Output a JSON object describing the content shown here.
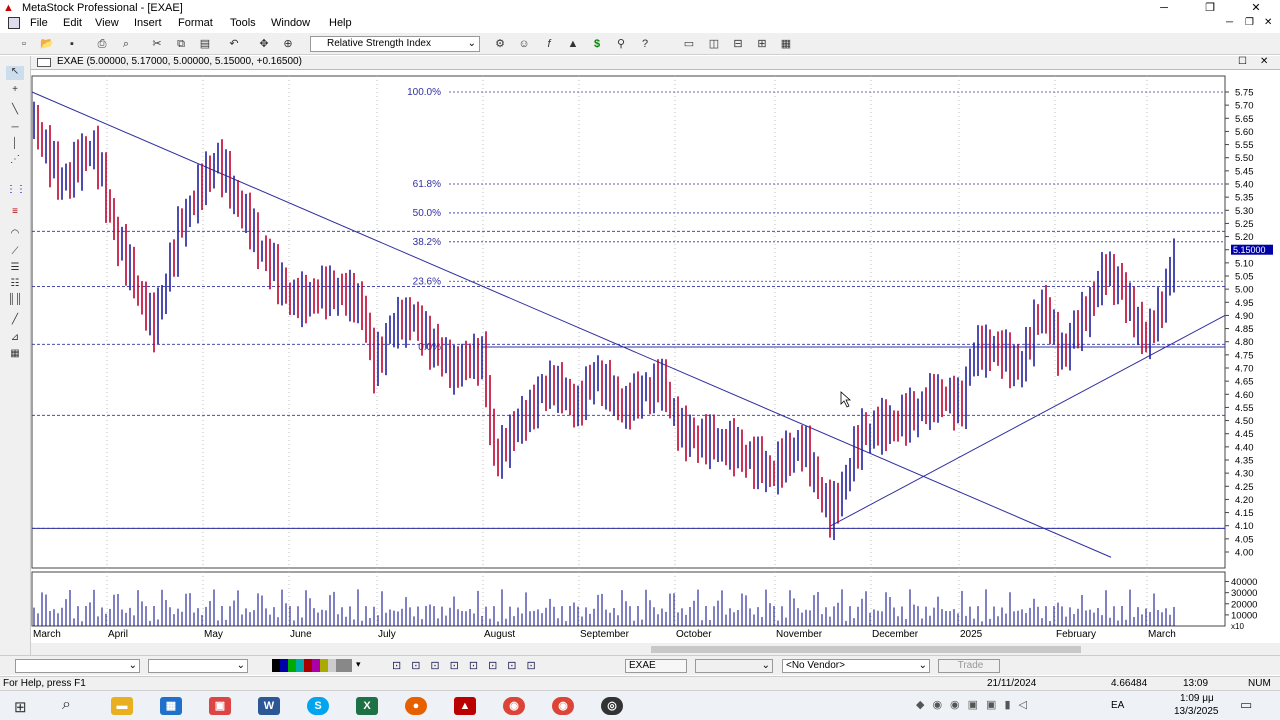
{
  "window": {
    "title": "MetaStock Professional - [EXAE]",
    "min": "─",
    "restore": "❐",
    "close": "✕"
  },
  "menu": [
    "File",
    "Edit",
    "View",
    "Insert",
    "Format",
    "Tools",
    "Window",
    "Help"
  ],
  "toolbar": {
    "indicator": "Relative Strength Index"
  },
  "chart": {
    "header": "EXAE (5.00000, 5.17000, 5.00000, 5.15000, +0.16500)",
    "price_ticks": [
      "5.75",
      "5.70",
      "5.65",
      "5.60",
      "5.55",
      "5.50",
      "5.45",
      "5.40",
      "5.35",
      "5.30",
      "5.25",
      "5.20",
      "5.15",
      "5.10",
      "5.05",
      "5.00",
      "4.95",
      "4.90",
      "4.85",
      "4.80",
      "4.75",
      "4.70",
      "4.65",
      "4.60",
      "4.55",
      "4.50",
      "4.45",
      "4.40",
      "4.35",
      "4.30",
      "4.25",
      "4.20",
      "4.15",
      "4.10",
      "4.05",
      "4.00"
    ],
    "last_price": "5.15000",
    "fib_labels": [
      "100.0%",
      "61.8%",
      "50.0%",
      "38.2%",
      "23.6%",
      "0.0%"
    ],
    "volume_ticks": [
      "40000",
      "30000",
      "20000",
      "10000"
    ],
    "volume_unit": "x10",
    "months": [
      "March",
      "April",
      "May",
      "June",
      "July",
      "August",
      "September",
      "October",
      "November",
      "December",
      "2025",
      "February",
      "March"
    ],
    "colors": {
      "up": "#2020a0",
      "down": "#c00030",
      "lines": "#3030a0"
    }
  },
  "chart_data": {
    "type": "bar",
    "title": "EXAE",
    "x_range": [
      "March 2024",
      "March 2025"
    ],
    "ylim": [
      3.97,
      5.78
    ],
    "last": {
      "open": 5.0,
      "high": 5.17,
      "low": 5.0,
      "close": 5.15,
      "change": 0.165
    },
    "fibonacci": [
      {
        "level": "100.0%",
        "price": 5.75
      },
      {
        "level": "61.8%",
        "price": 5.4
      },
      {
        "level": "50.0%",
        "price": 5.29
      },
      {
        "level": "38.2%",
        "price": 5.18
      },
      {
        "level": "23.6%",
        "price": 5.03
      },
      {
        "level": "0.0%",
        "price": 4.78
      }
    ],
    "horizontal_lines": [
      5.22,
      5.01,
      4.79,
      4.52,
      4.09
    ],
    "trendlines": [
      {
        "from": [
          "March",
          "5.75"
        ],
        "to": [
          "December",
          "3.95"
        ]
      },
      {
        "from": [
          "November",
          "4.10"
        ],
        "to": [
          "March",
          "4.90"
        ]
      }
    ]
  },
  "bottom": {
    "symbol": "EXAE",
    "vendor": "<No Vendor>",
    "trade": "Trade"
  },
  "status": {
    "help": "For Help, press F1",
    "date": "21/11/2024",
    "value": "4.66484",
    "time": "13:09",
    "num": "NUM"
  },
  "taskbar": {
    "lang": "EA",
    "time": "1:09 μμ",
    "date": "13/3/2025"
  }
}
